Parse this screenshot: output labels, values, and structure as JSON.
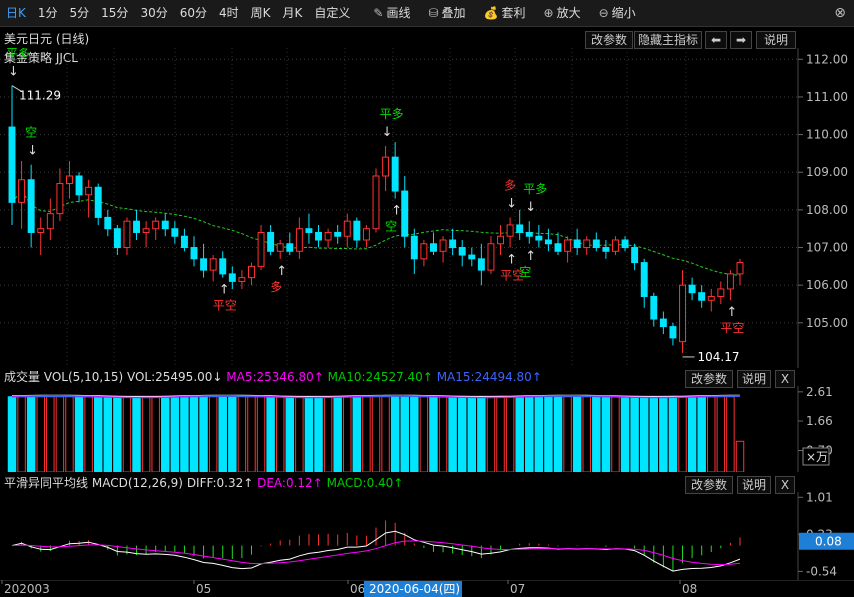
{
  "toolbar": {
    "periods": [
      "日K",
      "1分",
      "5分",
      "15分",
      "30分",
      "60分",
      "4时",
      "周K",
      "月K",
      "自定义"
    ],
    "tools": [
      {
        "label": "画线",
        "icon": "pencil-icon",
        "glyph": "✎"
      },
      {
        "label": "叠加",
        "icon": "stack-icon",
        "glyph": "⛁"
      },
      {
        "label": "套利",
        "icon": "moneybag-icon",
        "glyph": "💰"
      },
      {
        "label": "放大",
        "icon": "zoom-in-icon",
        "glyph": "⊕"
      },
      {
        "label": "缩小",
        "icon": "zoom-out-icon",
        "glyph": "⊖"
      }
    ],
    "close_glyph": "⊗"
  },
  "main": {
    "title": "美元日元 (日线)",
    "strategy": "集金策略 JJCL",
    "buttons": {
      "params": "改参数",
      "hide": "隐藏主指标",
      "prev": "⬅",
      "next": "➡",
      "help": "说明"
    },
    "max_label": "111.29",
    "min_label": "104.17",
    "y_ticks": [
      "112.00",
      "111.00",
      "110.00",
      "109.00",
      "108.00",
      "107.00",
      "106.00",
      "105.00"
    ],
    "signals": {
      "flat_long": "平多",
      "short": "空",
      "long": "多",
      "flat_short": "平空"
    }
  },
  "volume": {
    "name": "成交量",
    "params": "VOL(5,10,15)",
    "vol": "VOL:25495.00↓",
    "ma5": "MA5:25346.80↑",
    "ma10": "MA10:24527.40↑",
    "ma15": "MA15:24494.80↑",
    "buttons": {
      "params": "改参数",
      "help": "说明",
      "close": "X"
    },
    "y_ticks": [
      "2.61",
      "1.66",
      "0.70"
    ],
    "unit": "×万"
  },
  "macd": {
    "name": "平滑异同平均线",
    "params": "MACD(12,26,9)",
    "diff": "DIFF:0.32↑",
    "dea": "DEA:0.12↑",
    "macd": "MACD:0.40↑",
    "buttons": {
      "params": "改参数",
      "help": "说明",
      "close": "X"
    },
    "y_ticks": [
      "1.01",
      "0.23",
      "-0.54"
    ],
    "current": "0.08"
  },
  "x_axis": {
    "labels": [
      "202003",
      "05",
      "06",
      "07",
      "08"
    ],
    "cursor_date": "2020-06-04(四)"
  },
  "colors": {
    "up": "#ff3232",
    "down": "#00e5ff",
    "ma5": "#ff00ff",
    "ma10": "#00c800",
    "ma15": "#3c64ff",
    "green_sig": "#00dd00",
    "red_sig": "#ff3232",
    "accent": "#3aa0ff"
  },
  "chart_data": {
    "type": "candlestick",
    "title": "美元日元 (日线)",
    "ylim": [
      103.8,
      112.3
    ],
    "candles": [
      [
        110.2,
        111.3,
        107.6,
        108.2
      ],
      [
        108.2,
        109.3,
        107.5,
        108.8
      ],
      [
        108.8,
        109.2,
        107.0,
        107.4
      ],
      [
        107.4,
        107.8,
        106.8,
        107.5
      ],
      [
        107.5,
        108.3,
        107.2,
        107.9
      ],
      [
        107.9,
        109.1,
        107.7,
        108.7
      ],
      [
        108.7,
        109.3,
        108.3,
        108.9
      ],
      [
        108.9,
        109.0,
        108.2,
        108.4
      ],
      [
        108.4,
        108.8,
        107.8,
        108.6
      ],
      [
        108.6,
        108.7,
        107.6,
        107.8
      ],
      [
        107.8,
        108.0,
        107.3,
        107.5
      ],
      [
        107.5,
        107.6,
        106.8,
        107.0
      ],
      [
        107.0,
        107.8,
        106.8,
        107.7
      ],
      [
        107.7,
        108.0,
        107.2,
        107.4
      ],
      [
        107.4,
        107.7,
        107.0,
        107.5
      ],
      [
        107.5,
        107.8,
        107.2,
        107.7
      ],
      [
        107.7,
        107.9,
        107.3,
        107.5
      ],
      [
        107.5,
        107.7,
        107.1,
        107.3
      ],
      [
        107.3,
        107.5,
        106.9,
        107.0
      ],
      [
        107.0,
        107.3,
        106.5,
        106.7
      ],
      [
        106.7,
        107.1,
        106.2,
        106.4
      ],
      [
        106.4,
        106.8,
        106.1,
        106.7
      ],
      [
        106.7,
        106.9,
        106.2,
        106.3
      ],
      [
        106.3,
        106.5,
        105.9,
        106.1
      ],
      [
        106.1,
        106.4,
        105.9,
        106.2
      ],
      [
        106.2,
        106.6,
        106.0,
        106.5
      ],
      [
        106.5,
        107.6,
        106.4,
        107.4
      ],
      [
        107.4,
        107.6,
        106.8,
        106.9
      ],
      [
        106.9,
        107.2,
        106.7,
        107.1
      ],
      [
        107.1,
        107.4,
        106.8,
        106.9
      ],
      [
        106.9,
        107.8,
        106.7,
        107.5
      ],
      [
        107.5,
        107.9,
        107.1,
        107.4
      ],
      [
        107.4,
        107.6,
        107.0,
        107.2
      ],
      [
        107.2,
        107.5,
        107.0,
        107.4
      ],
      [
        107.4,
        107.6,
        107.1,
        107.3
      ],
      [
        107.3,
        107.9,
        107.0,
        107.7
      ],
      [
        107.7,
        107.8,
        107.0,
        107.2
      ],
      [
        107.2,
        107.6,
        107.0,
        107.5
      ],
      [
        107.5,
        109.1,
        107.4,
        108.9
      ],
      [
        108.9,
        109.7,
        108.5,
        109.4
      ],
      [
        109.4,
        109.8,
        108.3,
        108.5
      ],
      [
        108.5,
        108.9,
        107.0,
        107.3
      ],
      [
        107.3,
        107.5,
        106.3,
        106.7
      ],
      [
        106.7,
        107.2,
        106.5,
        107.1
      ],
      [
        107.1,
        107.4,
        106.8,
        106.9
      ],
      [
        106.9,
        107.3,
        106.6,
        107.2
      ],
      [
        107.2,
        107.5,
        106.8,
        107.0
      ],
      [
        107.0,
        107.2,
        106.5,
        106.8
      ],
      [
        106.8,
        107.0,
        106.5,
        106.7
      ],
      [
        106.7,
        107.1,
        106.0,
        106.4
      ],
      [
        106.4,
        107.3,
        106.3,
        107.1
      ],
      [
        107.1,
        107.6,
        106.8,
        107.3
      ],
      [
        107.3,
        107.8,
        107.0,
        107.6
      ],
      [
        107.6,
        108.0,
        107.2,
        107.4
      ],
      [
        107.4,
        107.7,
        107.1,
        107.3
      ],
      [
        107.3,
        107.6,
        107.0,
        107.2
      ],
      [
        107.2,
        107.5,
        106.9,
        107.1
      ],
      [
        107.1,
        107.4,
        106.8,
        106.9
      ],
      [
        106.9,
        107.3,
        106.6,
        107.2
      ],
      [
        107.2,
        107.5,
        106.8,
        107.0
      ],
      [
        107.0,
        107.3,
        106.8,
        107.2
      ],
      [
        107.2,
        107.4,
        106.9,
        107.0
      ],
      [
        107.0,
        107.2,
        106.7,
        106.9
      ],
      [
        106.9,
        107.3,
        106.8,
        107.2
      ],
      [
        107.2,
        107.3,
        106.9,
        107.0
      ],
      [
        107.0,
        107.1,
        106.4,
        106.6
      ],
      [
        106.6,
        106.7,
        105.4,
        105.7
      ],
      [
        105.7,
        105.8,
        104.9,
        105.1
      ],
      [
        105.1,
        105.3,
        104.7,
        104.9
      ],
      [
        104.9,
        105.0,
        104.4,
        104.6
      ],
      [
        104.5,
        106.4,
        104.2,
        106.0
      ],
      [
        106.0,
        106.2,
        105.6,
        105.8
      ],
      [
        105.8,
        106.0,
        105.4,
        105.6
      ],
      [
        105.6,
        105.9,
        105.3,
        105.7
      ],
      [
        105.7,
        106.1,
        105.5,
        105.9
      ],
      [
        105.9,
        106.4,
        105.6,
        106.3
      ],
      [
        106.3,
        106.7,
        106.0,
        106.6
      ]
    ]
  }
}
